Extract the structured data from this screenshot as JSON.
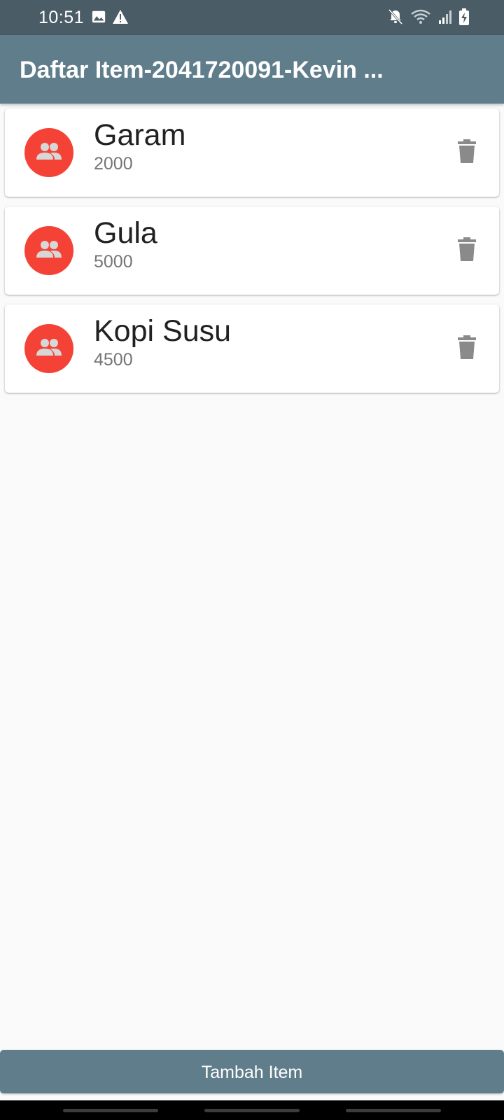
{
  "status_bar": {
    "time": "10:51",
    "left_icons": [
      "image-icon",
      "warning-icon"
    ],
    "right_icons": [
      "mute-icon",
      "wifi-icon",
      "signal-icon",
      "battery-charging-icon"
    ]
  },
  "app_bar": {
    "title": "Daftar Item-2041720091-Kevin ..."
  },
  "items": [
    {
      "name": "Garam",
      "price": "2000",
      "avatar_icon": "people-icon",
      "action_icon": "delete-icon"
    },
    {
      "name": "Gula",
      "price": "5000",
      "avatar_icon": "people-icon",
      "action_icon": "delete-icon"
    },
    {
      "name": "Kopi Susu",
      "price": "4500",
      "avatar_icon": "people-icon",
      "action_icon": "delete-icon"
    }
  ],
  "add_button": {
    "label": "Tambah Item"
  },
  "colors": {
    "app_bar": "#607d8b",
    "status_bar": "#4a5c66",
    "avatar": "#f44336",
    "delete_icon": "#8a8a8a",
    "background": "#fafafa"
  }
}
